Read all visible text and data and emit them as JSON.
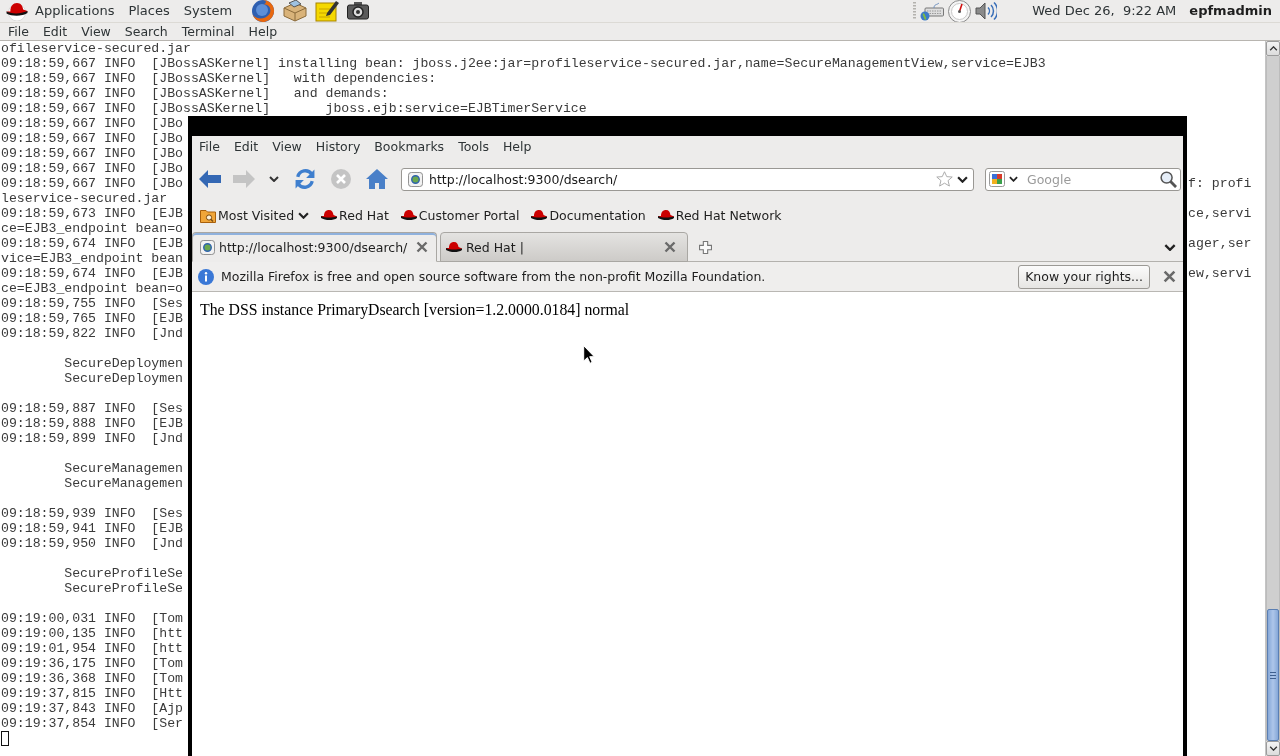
{
  "top_panel": {
    "menus": [
      "Applications",
      "Places",
      "System"
    ],
    "clock": "Wed Dec 26,  9:22 AM",
    "user": "epfmadmin"
  },
  "terminal": {
    "menu": [
      "File",
      "Edit",
      "View",
      "Search",
      "Terminal",
      "Help"
    ],
    "output": [
      [
        {
          "kind": "plain",
          "text": "ofileservice-secured.jar"
        },
        {
          "kind": "plain",
          "text": "09:18:59,667 INFO  [JBossASKernel] installing bean: jboss.j2ee:jar=profileservice-secured.jar,name=SecureManagementView,service=EJB3"
        },
        {
          "kind": "plain",
          "text": "09:18:59,667 INFO  [JBossASKernel]   with dependencies:"
        },
        {
          "kind": "plain",
          "text": "09:18:59,667 INFO  [JBossASKernel]   and demands:"
        },
        {
          "kind": "plain",
          "text": "09:18:59,667 INFO  [JBossASKernel]       jboss.ejb:service=EJBTimerService"
        },
        {
          "kind": "plain",
          "text": "09:18:59,667 INFO  [JBo"
        },
        {
          "kind": "plain",
          "text": "09:18:59,667 INFO  [JBo"
        },
        {
          "kind": "plain",
          "text": "09:18:59,667 INFO  [JBo"
        },
        {
          "kind": "plain",
          "text": "09:18:59,667 INFO  [JBo"
        },
        {
          "kind": "plain",
          "text": "09:18:59,667 INFO  [JBo",
          "tail": "f: profi"
        },
        {
          "kind": "plain",
          "text": "leservice-secured.jar"
        },
        {
          "kind": "plain",
          "text": "09:18:59,673 INFO  [EJB",
          "tail": "ce,servi"
        },
        {
          "kind": "plain",
          "text": "ce=EJB3_endpoint bean=o"
        },
        {
          "kind": "plain",
          "text": "09:18:59,674 INFO  [EJB",
          "tail": "ager,ser"
        },
        {
          "kind": "plain",
          "text": "vice=EJB3_endpoint bean"
        },
        {
          "kind": "plain",
          "text": "09:18:59,674 INFO  [EJB",
          "tail": "ew,servi"
        },
        {
          "kind": "plain",
          "text": "ce=EJB3_endpoint bean=o"
        },
        {
          "kind": "plain",
          "text": "09:18:59,755 INFO  [Ses"
        },
        {
          "kind": "plain",
          "text": "09:18:59,765 INFO  [EJB"
        },
        {
          "kind": "plain",
          "text": "09:18:59,822 INFO  [Jnd"
        }
      ],
      [
        {
          "kind": "indented",
          "text": "SecureDeploymen"
        },
        {
          "kind": "indented",
          "text": "SecureDeploymen"
        }
      ],
      [
        {
          "kind": "plain",
          "text": "09:18:59,887 INFO  [Ses"
        },
        {
          "kind": "plain",
          "text": "09:18:59,888 INFO  [EJB"
        },
        {
          "kind": "plain",
          "text": "09:18:59,899 INFO  [Jnd"
        }
      ],
      [
        {
          "kind": "indented",
          "text": "SecureManagemen"
        },
        {
          "kind": "indented",
          "text": "SecureManagemen"
        }
      ],
      [
        {
          "kind": "plain",
          "text": "09:18:59,939 INFO  [Ses"
        },
        {
          "kind": "plain",
          "text": "09:18:59,941 INFO  [EJB"
        },
        {
          "kind": "plain",
          "text": "09:18:59,950 INFO  [Jnd"
        }
      ],
      [
        {
          "kind": "indented",
          "text": "SecureProfileSe"
        },
        {
          "kind": "indented",
          "text": "SecureProfileSe"
        }
      ],
      [
        {
          "kind": "plain",
          "text": "09:19:00,031 INFO  [Tom"
        },
        {
          "kind": "plain",
          "text": "09:19:00,135 INFO  [htt"
        },
        {
          "kind": "plain",
          "text": "09:19:01,954 INFO  [htt"
        },
        {
          "kind": "plain",
          "text": "09:19:36,175 INFO  [Tom"
        },
        {
          "kind": "plain",
          "text": "09:19:36,368 INFO  [Tom"
        },
        {
          "kind": "plain",
          "text": "09:19:37,815 INFO  [Htt"
        },
        {
          "kind": "plain",
          "text": "09:19:37,843 INFO  [Ajp"
        },
        {
          "kind": "plain",
          "text": "09:19:37,854 INFO  [Ser"
        }
      ]
    ]
  },
  "browser": {
    "menu": [
      "File",
      "Edit",
      "View",
      "History",
      "Bookmarks",
      "Tools",
      "Help"
    ],
    "nav": [
      {
        "kind": "back",
        "disabled": false
      },
      {
        "kind": "forward",
        "disabled": true
      },
      {
        "kind": "recent",
        "disabled": false
      },
      {
        "kind": "reload",
        "disabled": false
      },
      {
        "kind": "stop",
        "disabled": true
      },
      {
        "kind": "home",
        "disabled": false
      }
    ],
    "url": "http://localhost:9300/dsearch/",
    "search": {
      "placeholder": "Google"
    },
    "bookmarks": [
      {
        "kind": "folder",
        "label": "Most Visited"
      },
      {
        "kind": "site",
        "label": "Red Hat"
      },
      {
        "kind": "site",
        "label": "Customer Portal"
      },
      {
        "kind": "site",
        "label": "Documentation"
      },
      {
        "kind": "site",
        "label": "Red Hat Network"
      }
    ],
    "tabs": [
      {
        "kind": "page",
        "title": "http://localhost:9300/dsearch/",
        "selected": true
      },
      {
        "kind": "site",
        "title": "Red Hat |",
        "selected": false
      }
    ],
    "notification": {
      "message": "Mozilla Firefox is free and open source software from the non-profit Mozilla Foundation.",
      "button": "Know your rights..."
    },
    "content": "The DSS instance PrimaryDsearch [version=1.2.0000.0184] normal"
  }
}
